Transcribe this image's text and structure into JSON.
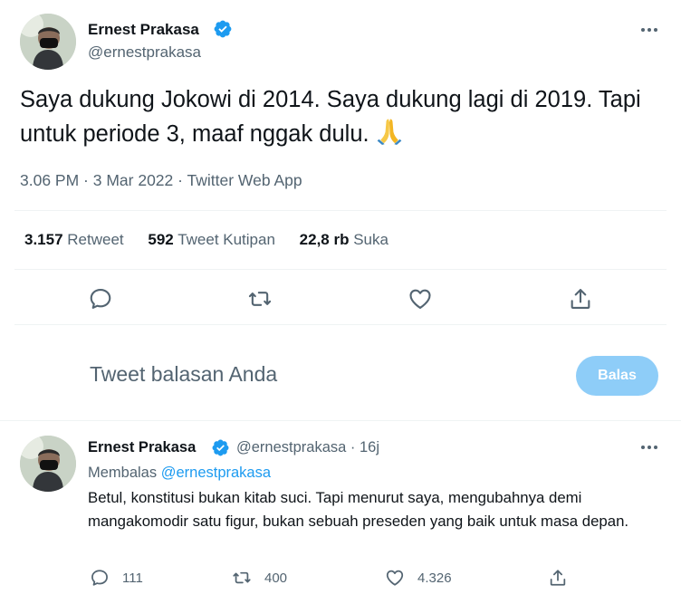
{
  "tweet": {
    "author_name": "Ernest Prakasa",
    "author_handle": "@ernestprakasa",
    "text": "Saya dukung Jokowi di 2014. Saya dukung lagi di 2019. Tapi untuk periode 3, maaf nggak dulu.",
    "emoji": "folded-hands",
    "time": "3.06 PM",
    "date": "3 Mar 2022",
    "source": "Twitter Web App",
    "separator": " · ",
    "stats": {
      "retweets_count": "3.157",
      "retweets_label": "Retweet",
      "quotes_count": "592",
      "quotes_label": "Tweet Kutipan",
      "likes_count": "22,8 rb",
      "likes_label": "Suka"
    },
    "icons": [
      "more-icon",
      "verified-badge-icon",
      "reply-icon",
      "retweet-icon",
      "like-icon",
      "share-icon"
    ]
  },
  "composer": {
    "placeholder": "Tweet balasan Anda",
    "button_label": "Balas"
  },
  "reply": {
    "author_name": "Ernest Prakasa",
    "author_handle": "@ernestprakasa",
    "time_ago": "16j",
    "replying_label": "Membalas",
    "replying_to": "@ernestprakasa",
    "text": "Betul, konstitusi bukan kitab suci. Tapi menurut saya, mengubahnya demi mangakomodir satu figur, bukan sebuah preseden yang baik untuk masa depan.",
    "reply_count": "111",
    "retweet_count": "400",
    "like_count": "4.326"
  },
  "colors": {
    "text": "#0f1419",
    "secondary": "#536471",
    "accent": "#1d9bf0",
    "button_disabled": "#8ecdf8",
    "divider": "#eff3f4"
  }
}
